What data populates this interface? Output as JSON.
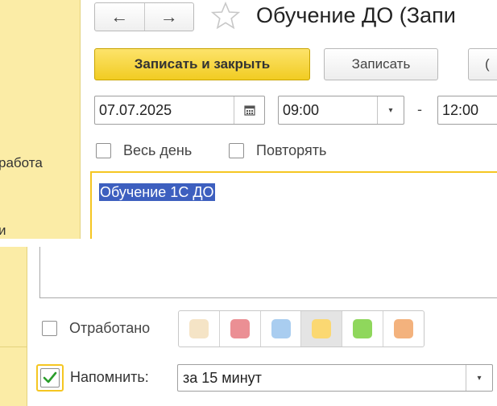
{
  "left_strip": {
    "text_1": "работа",
    "text_2": "и"
  },
  "header": {
    "back_glyph": "←",
    "forward_glyph": "→",
    "star_icon": "star-icon",
    "title": "Обучение ДО (Запи"
  },
  "toolbar": {
    "save_close_label": "Записать и закрыть",
    "save_label": "Записать",
    "third_label": "("
  },
  "schedule": {
    "date": "07.07.2025",
    "start_time": "09:00",
    "dash": "-",
    "end_time": "12:00",
    "all_day_label": "Весь день",
    "repeat_label": "Повторять"
  },
  "editor": {
    "selected_text": "Обучение 1С ДО"
  },
  "status": {
    "worked_label": "Отработано",
    "colors": [
      "#f5e4c6",
      "#eb8f94",
      "#a9cdf0",
      "#fbd872",
      "#8fd75c",
      "#f3b27d"
    ],
    "selected_color_index": 3
  },
  "reminder": {
    "label": "Напомнить:",
    "checked": true,
    "value": "за 15 минут"
  },
  "accent_color": "#f5c622"
}
